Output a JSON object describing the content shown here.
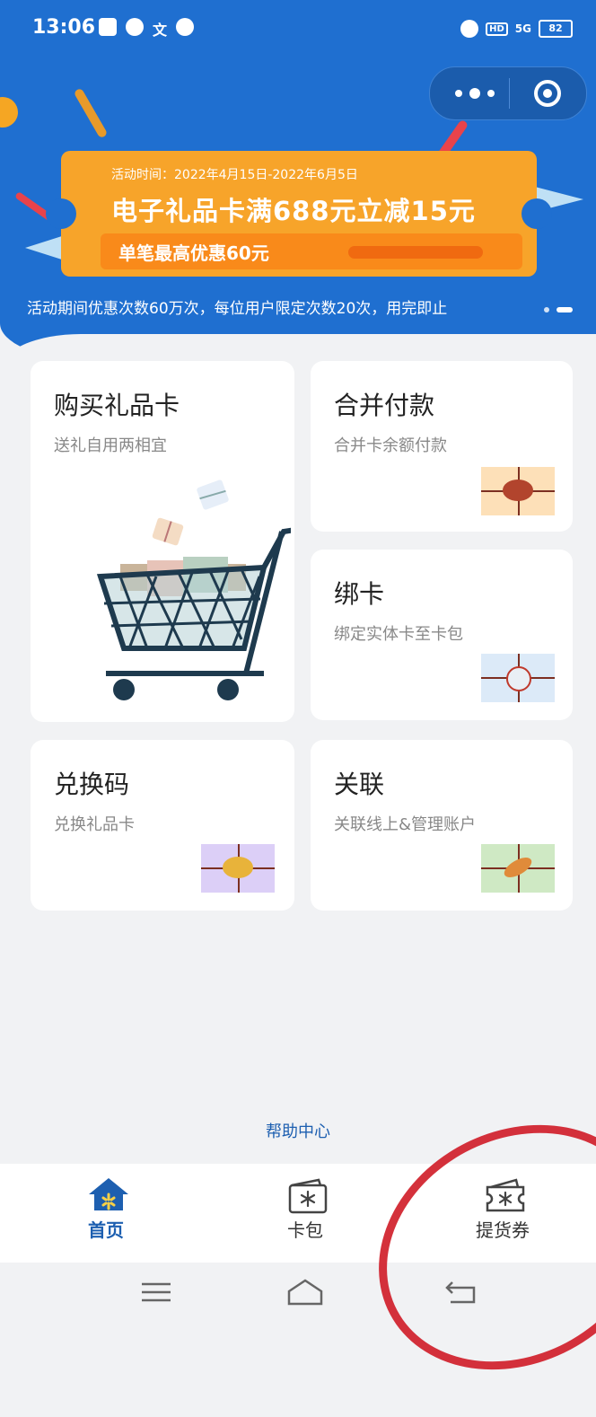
{
  "status_bar": {
    "time": "13:06",
    "battery": "82",
    "network": "5G",
    "hd": "HD"
  },
  "banner": {
    "activity_time": "活动时间：2022年4月15日-2022年6月5日",
    "headline": "电子礼品卡满688元立减15元",
    "subline": "单笔最高优惠60元",
    "note": "活动期间优惠次数60万次，每位用户限定次数20次，用完即止"
  },
  "cards": {
    "buy": {
      "title": "购买礼品卡",
      "subtitle": "送礼自用两相宜"
    },
    "combine": {
      "title": "合并付款",
      "subtitle": "合并卡余额付款"
    },
    "bind": {
      "title": "绑卡",
      "subtitle": "绑定实体卡至卡包"
    },
    "redeem": {
      "title": "兑换码",
      "subtitle": "兑换礼品卡"
    },
    "link": {
      "title": "关联",
      "subtitle": "关联线上&管理账户"
    }
  },
  "help_center": "帮助中心",
  "tabs": [
    {
      "label": "首页",
      "icon": "home-icon",
      "active": true
    },
    {
      "label": "卡包",
      "icon": "card-wallet-icon",
      "active": false
    },
    {
      "label": "提货券",
      "icon": "voucher-icon",
      "active": false
    }
  ],
  "colors": {
    "primary": "#1f6fd0",
    "accent_orange": "#f7a42a",
    "annotation_red": "#d0202a"
  }
}
